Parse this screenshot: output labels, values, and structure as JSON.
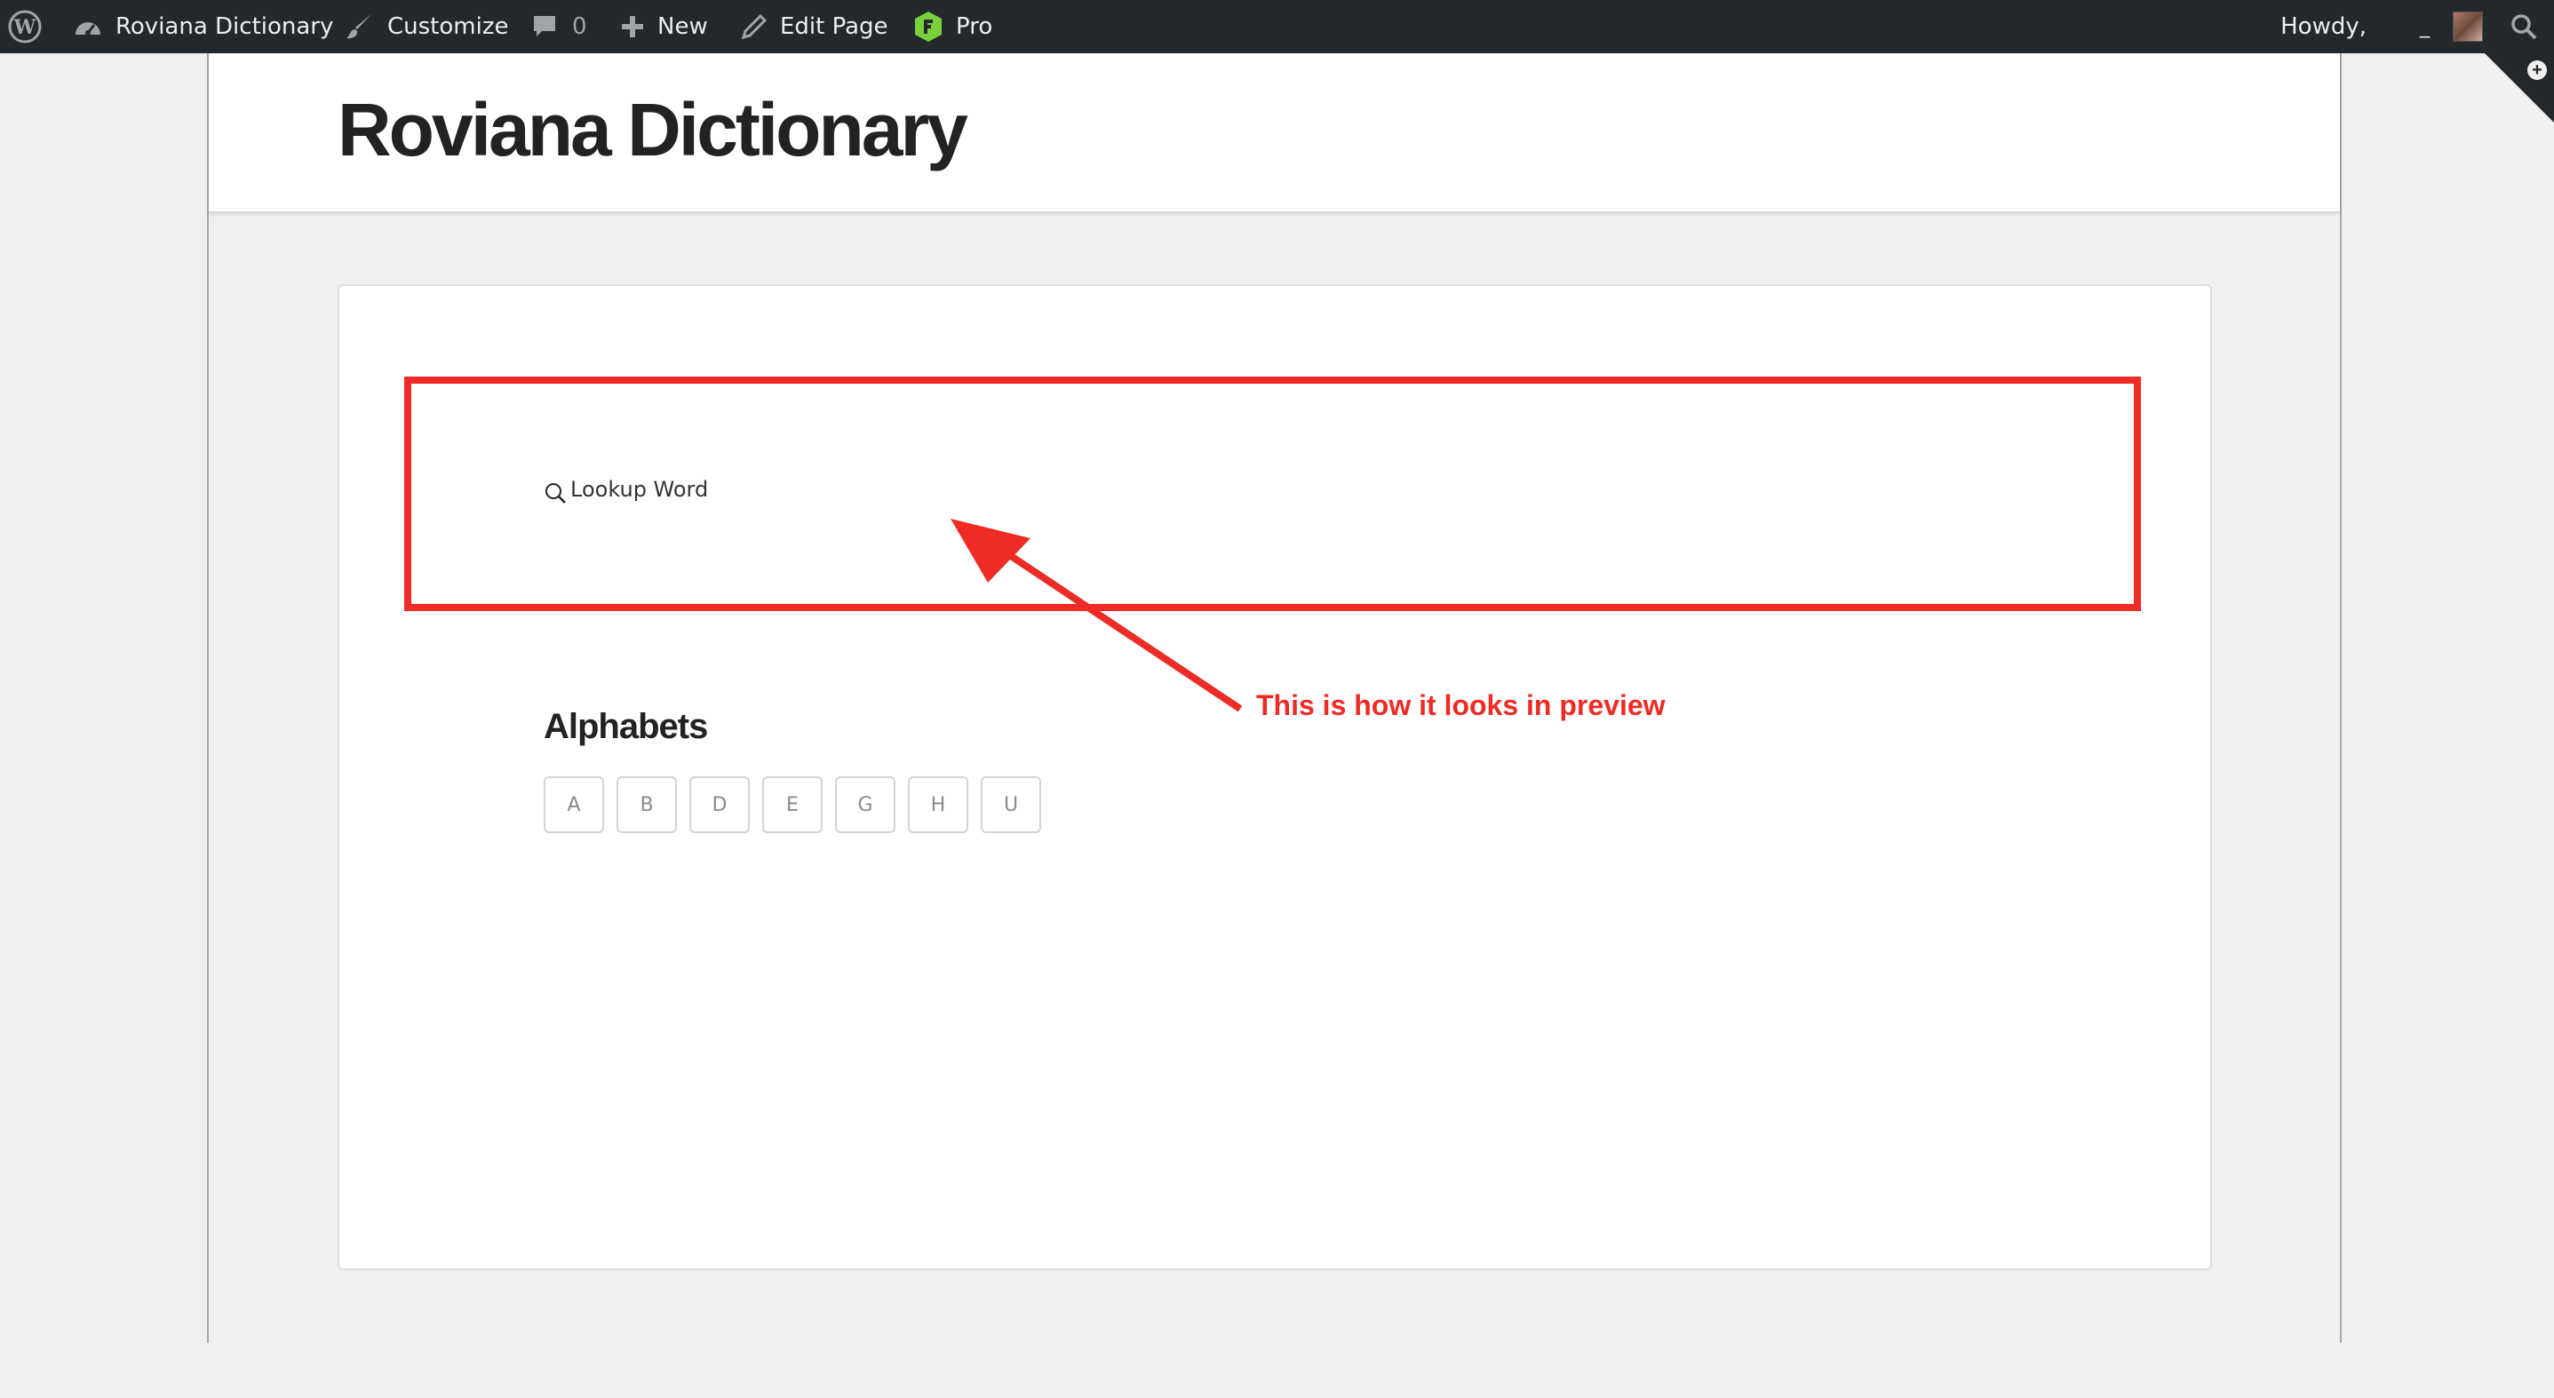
{
  "admin_bar": {
    "site_name": "Roviana Dictionary",
    "customize_label": "Customize",
    "comments_count": "0",
    "new_label": "New",
    "edit_page_label": "Edit Page",
    "pro_label": "Pro",
    "howdy_label": "Howdy,",
    "user_name": "_",
    "colors": {
      "background": "#23282d",
      "text": "#eeeeee",
      "pro_badge": "#7ad03a"
    }
  },
  "site": {
    "title": "Roviana Dictionary"
  },
  "search": {
    "placeholder": "Lookup Word",
    "icon": "search-icon"
  },
  "alphabets": {
    "heading": "Alphabets",
    "letters": [
      "A",
      "B",
      "D",
      "E",
      "G",
      "H",
      "U"
    ]
  },
  "annotation": {
    "text": "This is how it looks in preview",
    "color": "#ee2b24"
  }
}
